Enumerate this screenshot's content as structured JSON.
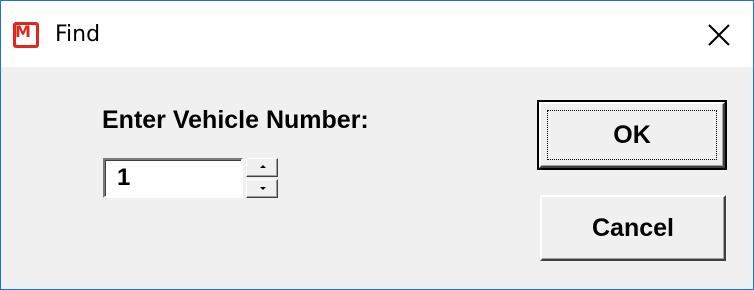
{
  "window": {
    "title": "Find",
    "app_icon_letter": "M",
    "app_icon_color": "#e0271b",
    "close_icon": "close-icon",
    "border_color": "#1a73d9"
  },
  "form": {
    "prompt_label": "Enter Vehicle Number:",
    "vehicle_number_value": "1",
    "spin_up_icon": "spin-up-arrow-icon",
    "spin_down_icon": "spin-down-arrow-icon"
  },
  "buttons": {
    "ok_label": "OK",
    "cancel_label": "Cancel"
  }
}
